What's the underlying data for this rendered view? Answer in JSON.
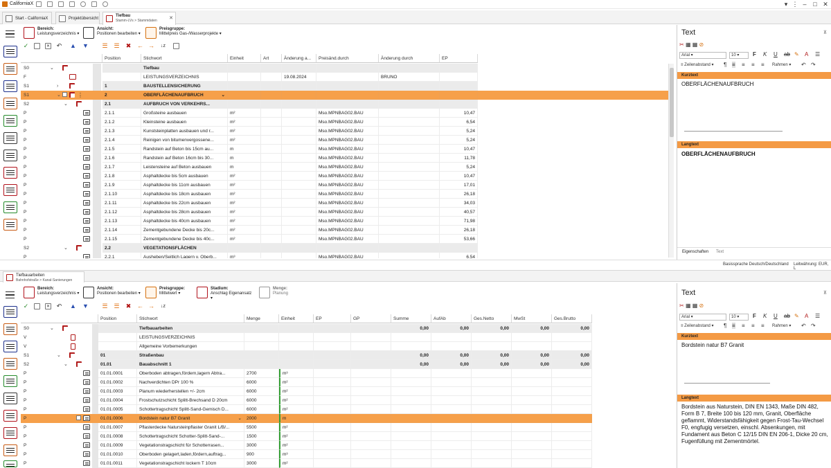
{
  "app": {
    "title": "CaliforniaX"
  },
  "tabs": [
    {
      "label": "Start - CaliforniaX",
      "sub": ""
    },
    {
      "label": "Projektübersicht",
      "sub": ""
    },
    {
      "label": "Tiefbau",
      "sub": "Stamm-LVs > Stammdaten"
    }
  ],
  "top": {
    "ribbon": [
      {
        "title": "Bereich:",
        "value": "Leistungsverzeichnis"
      },
      {
        "title": "Ansicht:",
        "value": "Positionen bearbeiten"
      },
      {
        "title": "Preisgruppe:",
        "value": "Mittelpreis Gas-/Wasserprojekte"
      }
    ],
    "columns": [
      "Position",
      "Stichwort",
      "Einheit",
      "Art",
      "Änderung a...",
      "Preisänd.durch",
      "Änderung durch",
      "EP"
    ],
    "rows": [
      {
        "lvl": "S0",
        "pos": "",
        "stich": "Tiefbau",
        "einheit": "",
        "aend": "",
        "preis": "",
        "aenddurch": "",
        "ep": "",
        "type": "S0"
      },
      {
        "lvl": "F",
        "pos": "",
        "stich": "LEISTUNGSVERZEICHNIS",
        "einheit": "",
        "aend": "19.08.2024",
        "preis": "",
        "aenddurch": "BRUNO",
        "ep": "",
        "type": "F"
      },
      {
        "lvl": "S1",
        "pos": "1",
        "stich": "BAUSTELLENSICHERUNG",
        "einheit": "",
        "aend": "",
        "preis": "",
        "aenddurch": "",
        "ep": "",
        "type": "S1c"
      },
      {
        "lvl": "S1",
        "pos": "2",
        "stich": "OBERFLÄCHENAUFBRUCH",
        "einheit": "",
        "aend": "",
        "preis": "",
        "aenddurch": "",
        "ep": "",
        "type": "sel"
      },
      {
        "lvl": "S2",
        "pos": "2.1",
        "stich": "AUFBRUCH VON VERKEHRS...",
        "einheit": "",
        "aend": "",
        "preis": "",
        "aenddurch": "",
        "ep": "",
        "type": "S2"
      },
      {
        "lvl": "P",
        "pos": "2.1.1",
        "stich": "Großsteine ausbauen",
        "einheit": "m²",
        "aend": "",
        "preis": "Mso.MPNBAG02.BAU",
        "aenddurch": "",
        "ep": "10,47",
        "type": "P"
      },
      {
        "lvl": "P",
        "pos": "2.1.2",
        "stich": "Kleinsteine ausbauen",
        "einheit": "m²",
        "aend": "",
        "preis": "Mso.MPNBAG02.BAU",
        "aenddurch": "",
        "ep": "6,54",
        "type": "P"
      },
      {
        "lvl": "P",
        "pos": "2.1.3",
        "stich": "Kunststeinplatten ausbauen und r...",
        "einheit": "m²",
        "aend": "",
        "preis": "Mso.MPNBAG02.BAU",
        "aenddurch": "",
        "ep": "5,24",
        "type": "P"
      },
      {
        "lvl": "P",
        "pos": "2.1.4",
        "stich": "Reinigen von bitumenvergossene...",
        "einheit": "m²",
        "aend": "",
        "preis": "Mso.MPNBAG02.BAU",
        "aenddurch": "",
        "ep": "5,24",
        "type": "P"
      },
      {
        "lvl": "P",
        "pos": "2.1.5",
        "stich": "Randstein auf Beton bis 15cm au...",
        "einheit": "m",
        "aend": "",
        "preis": "Mso.MPNBAG02.BAU",
        "aenddurch": "",
        "ep": "10,47",
        "type": "P"
      },
      {
        "lvl": "P",
        "pos": "2.1.6",
        "stich": "Randstein auf Beton 16cm bis 30...",
        "einheit": "m",
        "aend": "",
        "preis": "Mso.MPNBAG02.BAU",
        "aenddurch": "",
        "ep": "11,78",
        "type": "P"
      },
      {
        "lvl": "P",
        "pos": "2.1.7",
        "stich": "Leistensteine auf Beton ausbauen",
        "einheit": "m",
        "aend": "",
        "preis": "Mso.MPNBAG02.BAU",
        "aenddurch": "",
        "ep": "5,24",
        "type": "P"
      },
      {
        "lvl": "P",
        "pos": "2.1.8",
        "stich": "Asphaltdecke bis 5cm ausbauen",
        "einheit": "m²",
        "aend": "",
        "preis": "Mso.MPNBAG02.BAU",
        "aenddurch": "",
        "ep": "10,47",
        "type": "P"
      },
      {
        "lvl": "P",
        "pos": "2.1.9",
        "stich": "Asphaltdecke bis 11cm ausbauen",
        "einheit": "m²",
        "aend": "",
        "preis": "Mso.MPNBAG02.BAU",
        "aenddurch": "",
        "ep": "17,01",
        "type": "P"
      },
      {
        "lvl": "P",
        "pos": "2.1.10",
        "stich": "Asphaltdecke bis 18cm ausbauen",
        "einheit": "m²",
        "aend": "",
        "preis": "Mso.MPNBAG02.BAU",
        "aenddurch": "",
        "ep": "26,18",
        "type": "P"
      },
      {
        "lvl": "P",
        "pos": "2.1.11",
        "stich": "Asphaltdecke bis 22cm ausbauen",
        "einheit": "m²",
        "aend": "",
        "preis": "Mso.MPNBAG02.BAU",
        "aenddurch": "",
        "ep": "34,03",
        "type": "P"
      },
      {
        "lvl": "P",
        "pos": "2.1.12",
        "stich": "Asphaltdecke bis 28cm ausbauen",
        "einheit": "m²",
        "aend": "",
        "preis": "Mso.MPNBAG02.BAU",
        "aenddurch": "",
        "ep": "40,57",
        "type": "P"
      },
      {
        "lvl": "P",
        "pos": "2.1.13",
        "stich": "Asphaltdecke bis 40cm ausbauen",
        "einheit": "m²",
        "aend": "",
        "preis": "Mso.MPNBAG02.BAU",
        "aenddurch": "",
        "ep": "71,98",
        "type": "P"
      },
      {
        "lvl": "P",
        "pos": "2.1.14",
        "stich": "Zementgebundene Decke bis 20c...",
        "einheit": "m²",
        "aend": "",
        "preis": "Mso.MPNBAG02.BAU",
        "aenddurch": "",
        "ep": "26,18",
        "type": "P"
      },
      {
        "lvl": "P",
        "pos": "2.1.15",
        "stich": "Zementgebundene Decke bis 40c...",
        "einheit": "m²",
        "aend": "",
        "preis": "Mso.MPNBAG02.BAU",
        "aenddurch": "",
        "ep": "53,66",
        "type": "P"
      },
      {
        "lvl": "S2",
        "pos": "2.2",
        "stich": "VEGETATIONSFLÄCHEN",
        "einheit": "",
        "aend": "",
        "preis": "",
        "aenddurch": "",
        "ep": "",
        "type": "S2"
      },
      {
        "lvl": "P",
        "pos": "2.2.1",
        "stich": "Ausheben/Seitlich Lagern v. Oberb...",
        "einheit": "m³",
        "aend": "",
        "preis": "Mso.MPNBAG02.BAU",
        "aenddurch": "",
        "ep": "6,54",
        "type": "P"
      }
    ],
    "text_panel": {
      "title": "Text",
      "font": "Arial",
      "size": "10",
      "zeilenabstand": "Zeilenabstand",
      "rahmen": "Rahmen",
      "kurztext_label": "Kurztext",
      "kurztext": "OBERFLÄCHENAUFBRUCH",
      "langtext_label": "Langtext",
      "langtext": "OBERFLÄCHENAUFBRUCH",
      "tabs": [
        "Eigenschaften",
        "Text"
      ]
    },
    "status": {
      "basis": "Basissprache Deutsch/Deutschland",
      "leit": "Leitwährung: EUR, L"
    }
  },
  "bottom": {
    "tab": {
      "label": "Tiefbauarbeiten",
      "sub": "Bahnhofstraße > Kanal-Sanierungen"
    },
    "ribbon": [
      {
        "title": "Bereich:",
        "value": "Leistungsverzeichnis"
      },
      {
        "title": "Ansicht:",
        "value": "Positionen bearbeiten"
      },
      {
        "title": "Preisgruppe:",
        "value": "Mittelwert"
      },
      {
        "title": "Stadium:",
        "value": "Anschlag Eigenansatz"
      },
      {
        "title": "Menge:",
        "value": "Planung"
      }
    ],
    "columns": [
      "Position",
      "Stichwort",
      "Menge",
      "Einheit",
      "EP",
      "GP",
      "Summe",
      "AufAb",
      "Ges.Netto",
      "MwSt",
      "Ges.Brutto"
    ],
    "rows": [
      {
        "lvl": "S0",
        "pos": "",
        "stich": "Tiefbauarbeiten",
        "menge": "",
        "einheit": "",
        "summe": "0,00",
        "aufab": "0,00",
        "netto": "0,00",
        "mwst": "0,00",
        "brutto": "0,00",
        "type": "S0"
      },
      {
        "lvl": "V",
        "pos": "",
        "stich": "LEISTUNGSVERZEICHNIS",
        "menge": "",
        "einheit": "",
        "summe": "",
        "aufab": "",
        "netto": "",
        "mwst": "",
        "brutto": "",
        "type": "V"
      },
      {
        "lvl": "V",
        "pos": "",
        "stich": "Allgemeine Vorbemerkungen",
        "menge": "",
        "einheit": "",
        "summe": "",
        "aufab": "",
        "netto": "",
        "mwst": "",
        "brutto": "",
        "type": "V"
      },
      {
        "lvl": "S1",
        "pos": "01",
        "stich": "Straßenbau",
        "menge": "",
        "einheit": "",
        "summe": "0,00",
        "aufab": "0,00",
        "netto": "0,00",
        "mwst": "0,00",
        "brutto": "0,00",
        "type": "S1"
      },
      {
        "lvl": "S2",
        "pos": "01.01",
        "stich": "Bauabschnitt 1",
        "menge": "",
        "einheit": "",
        "summe": "0,00",
        "aufab": "0,00",
        "netto": "0,00",
        "mwst": "0,00",
        "brutto": "0,00",
        "type": "S2"
      },
      {
        "lvl": "P",
        "pos": "01.01.0001",
        "stich": "Oberboden abtragen,fördern,lagern Abtra...",
        "menge": "2700",
        "einheit": "m³",
        "summe": "",
        "aufab": "",
        "netto": "",
        "mwst": "",
        "brutto": "",
        "type": "P"
      },
      {
        "lvl": "P",
        "pos": "01.01.0002",
        "stich": "Nachverdichten DPr 100 %",
        "menge": "6000",
        "einheit": "m²",
        "summe": "",
        "aufab": "",
        "netto": "",
        "mwst": "",
        "brutto": "",
        "type": "P"
      },
      {
        "lvl": "P",
        "pos": "01.01.0003",
        "stich": "Planum wiederherstellen +/- 2cm",
        "menge": "6000",
        "einheit": "m²",
        "summe": "",
        "aufab": "",
        "netto": "",
        "mwst": "",
        "brutto": "",
        "type": "P"
      },
      {
        "lvl": "P",
        "pos": "01.01.0004",
        "stich": "Frostschutzschicht Splitt-Brechsand D 20cm",
        "menge": "6000",
        "einheit": "m²",
        "summe": "",
        "aufab": "",
        "netto": "",
        "mwst": "",
        "brutto": "",
        "type": "P"
      },
      {
        "lvl": "P",
        "pos": "01.01.0005",
        "stich": "Schottertragschicht Splitt-Sand-Gemisch D...",
        "menge": "6000",
        "einheit": "m²",
        "summe": "",
        "aufab": "",
        "netto": "",
        "mwst": "",
        "brutto": "",
        "type": "P"
      },
      {
        "lvl": "P",
        "pos": "01.01.0006",
        "stich": "Bordstein natur B7 Granit",
        "menge": "2000",
        "einheit": "m",
        "summe": "",
        "aufab": "",
        "netto": "",
        "mwst": "",
        "brutto": "",
        "type": "sel"
      },
      {
        "lvl": "P",
        "pos": "01.01.0007",
        "stich": "Pflasterdecke Natursteinpflaster Granit L/B/...",
        "menge": "5500",
        "einheit": "m²",
        "summe": "",
        "aufab": "",
        "netto": "",
        "mwst": "",
        "brutto": "",
        "type": "P"
      },
      {
        "lvl": "P",
        "pos": "01.01.0008",
        "stich": "Schottertragschicht Schotter-Splitt-Sand-...",
        "menge": "1500",
        "einheit": "m²",
        "summe": "",
        "aufab": "",
        "netto": "",
        "mwst": "",
        "brutto": "",
        "type": "P"
      },
      {
        "lvl": "P",
        "pos": "01.01.0009",
        "stich": "Vegetationstragschicht für Schotterrasen...",
        "menge": "3000",
        "einheit": "m²",
        "summe": "",
        "aufab": "",
        "netto": "",
        "mwst": "",
        "brutto": "",
        "type": "P"
      },
      {
        "lvl": "P",
        "pos": "01.01.0010",
        "stich": "Oberboden gelagert,laden,fördern,auftrag...",
        "menge": "900",
        "einheit": "m³",
        "summe": "",
        "aufab": "",
        "netto": "",
        "mwst": "",
        "brutto": "",
        "type": "P"
      },
      {
        "lvl": "P",
        "pos": "01.01.0011",
        "stich": "Vegetationstragschicht lockern T 10cm",
        "menge": "3000",
        "einheit": "m²",
        "summe": "",
        "aufab": "",
        "netto": "",
        "mwst": "",
        "brutto": "",
        "type": "P"
      }
    ],
    "text_panel": {
      "title": "Text",
      "font": "Arial",
      "size": "10",
      "zeilenabstand": "Zeilenabstand",
      "rahmen": "Rahmen",
      "kurztext_label": "Kurztext",
      "kurztext": "Bordstein natur B7 Granit",
      "langtext_label": "Langtext",
      "langtext": "Bordstein aus Naturstein, DIN EN 1343, Maße DIN 482, Form B 7, Breite 100 bis 120 mm, Granit, Oberfläche geflammt, Widerstandsfähigkeit gegen Frost-Tau-Wechsel F0, engfugig versetzen, einschl. Absenkungen, mit Fundament aus Beton C 12/15 DIN EN 206-1, Dicke 20 cm, Fugenfüllung mit Zementmörtel."
    }
  },
  "colors": {
    "selection": "#f6a04a",
    "section_bar": "#f49a44",
    "accent_red": "#b01818"
  }
}
